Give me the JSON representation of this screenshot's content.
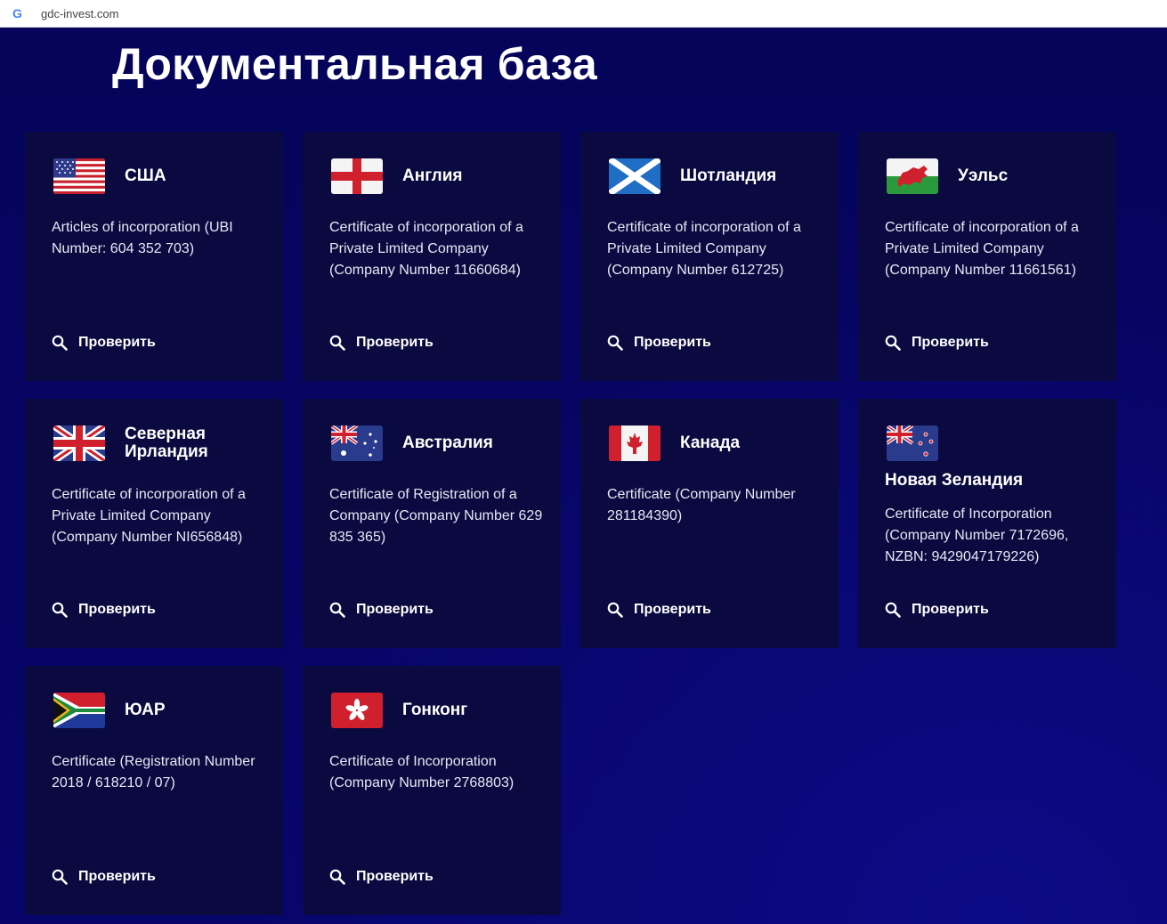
{
  "browser": {
    "url": "gdc-invest.com"
  },
  "page": {
    "title": "Документальная база"
  },
  "check_label": "Проверить",
  "cards": [
    {
      "country": "США",
      "flag": "us-flag-icon",
      "description": "Articles of incorporation (UBI Number: 604 352 703)"
    },
    {
      "country": "Англия",
      "flag": "england-flag-icon",
      "description": "Certificate of incorporation of a Private Limited Company (Company Number 11660684)"
    },
    {
      "country": "Шотландия",
      "flag": "scotland-flag-icon",
      "description": "Certificate of incorporation of a Private Limited Company (Company Number 612725)"
    },
    {
      "country": "Уэльс",
      "flag": "wales-flag-icon",
      "description": "Certificate of incorporation of a Private Limited Company (Company Number 11661561)"
    },
    {
      "country_line1": "Северная",
      "country_line2": "Ирландия",
      "flag": "uk-flag-icon",
      "description": "Certificate of incorporation of a Private Limited Company (Company Number NI656848)"
    },
    {
      "country": "Австралия",
      "flag": "australia-flag-icon",
      "description": "Certificate of Registration of a Company (Company Number 629 835 365)"
    },
    {
      "country": "Канада",
      "flag": "canada-flag-icon",
      "description": "Certificate (Company Number 281184390)"
    },
    {
      "country": "Новая Зеландия",
      "flag": "new-zealand-flag-icon",
      "description": "Certificate of Incorporation (Company Number 7172696, NZBN: 9429047179226)"
    },
    {
      "country": "ЮАР",
      "flag": "south-africa-flag-icon",
      "description": "Certificate (Registration Number 2018 / 618210 / 07)"
    },
    {
      "country": "Гонконг",
      "flag": "hong-kong-flag-icon",
      "description": "Certificate of Incorporation (Company Number 2768803)"
    }
  ]
}
